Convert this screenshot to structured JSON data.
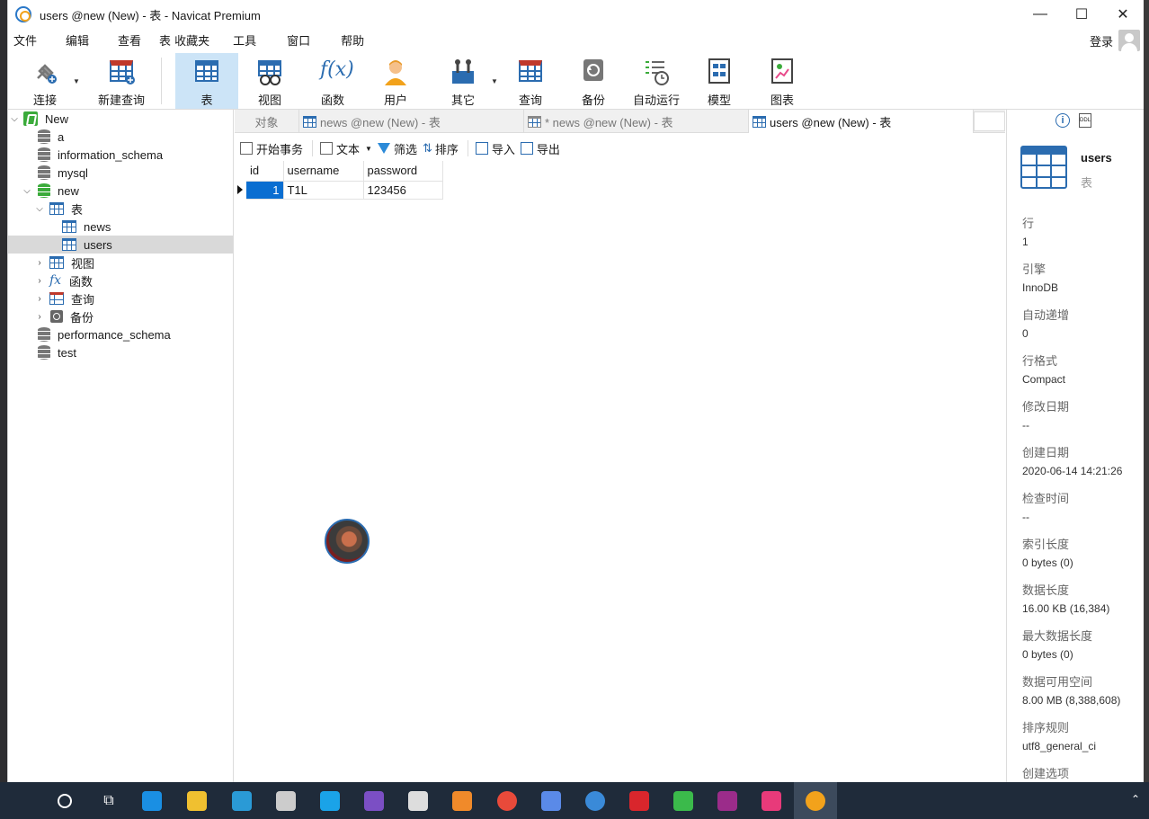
{
  "window": {
    "title": "users @new (New) - 表 - Navicat Premium",
    "controls": [
      "—",
      "☐",
      "✕"
    ]
  },
  "menu": [
    "文件",
    "编辑",
    "查看",
    "表",
    "收藏夹",
    "工具",
    "窗口",
    "帮助"
  ],
  "login_label": "登录",
  "toolbar": [
    {
      "label": "连接",
      "icon": "plug-icon",
      "has_arrow": true
    },
    {
      "label": "新建查询",
      "icon": "new-query-icon"
    },
    {
      "label": "表",
      "icon": "table-icon",
      "active": true
    },
    {
      "label": "视图",
      "icon": "view-icon"
    },
    {
      "label": "函数",
      "icon": "function-icon"
    },
    {
      "label": "用户",
      "icon": "user-icon"
    },
    {
      "label": "其它",
      "icon": "tools-icon",
      "has_arrow": true
    },
    {
      "label": "查询",
      "icon": "query-icon"
    },
    {
      "label": "备份",
      "icon": "backup-icon"
    },
    {
      "label": "自动运行",
      "icon": "schedule-icon"
    },
    {
      "label": "模型",
      "icon": "model-icon"
    },
    {
      "label": "图表",
      "icon": "chart-icon"
    }
  ],
  "tree": [
    {
      "label": "New",
      "type": "connection",
      "expanded": true
    },
    {
      "label": "a",
      "type": "db"
    },
    {
      "label": "information_schema",
      "type": "db"
    },
    {
      "label": "mysql",
      "type": "db"
    },
    {
      "label": "new",
      "type": "db-open",
      "expanded": true
    },
    {
      "label": "表",
      "type": "tables",
      "expanded": true
    },
    {
      "label": "news",
      "type": "table"
    },
    {
      "label": "users",
      "type": "table",
      "selected": true
    },
    {
      "label": "视图",
      "type": "views"
    },
    {
      "label": "函数",
      "type": "functions"
    },
    {
      "label": "查询",
      "type": "queries"
    },
    {
      "label": "备份",
      "type": "backups"
    },
    {
      "label": "performance_schema",
      "type": "db"
    },
    {
      "label": "test",
      "type": "db"
    }
  ],
  "tabs": [
    {
      "label": "对象"
    },
    {
      "label": "news @new (New) - 表"
    },
    {
      "label": "* news @new (New) - 表"
    },
    {
      "label": "users @new (New) - 表",
      "active": true
    }
  ],
  "data_toolbar": [
    "开始事务",
    "文本",
    "筛选",
    "排序",
    "导入",
    "导出"
  ],
  "grid": {
    "columns": [
      "id",
      "username",
      "password"
    ],
    "rows": [
      [
        "1",
        "T1L",
        "123456"
      ]
    ]
  },
  "info": {
    "name": "users",
    "type": "表",
    "props": [
      {
        "k": "行",
        "v": "1"
      },
      {
        "k": "引擎",
        "v": "InnoDB"
      },
      {
        "k": "自动递增",
        "v": "0"
      },
      {
        "k": "行格式",
        "v": "Compact"
      },
      {
        "k": "修改日期",
        "v": "--"
      },
      {
        "k": "创建日期",
        "v": "2020-06-14 14:21:26"
      },
      {
        "k": "检查时间",
        "v": "--"
      },
      {
        "k": "索引长度",
        "v": "0 bytes (0)"
      },
      {
        "k": "数据长度",
        "v": "16.00 KB (16,384)"
      },
      {
        "k": "最大数据长度",
        "v": "0 bytes (0)"
      },
      {
        "k": "数据可用空间",
        "v": "8.00 MB (8,388,608)"
      },
      {
        "k": "排序规则",
        "v": "utf8_general_ci"
      },
      {
        "k": "创建选项",
        "v": ""
      }
    ]
  },
  "taskbar": {
    "apps": [
      "search",
      "task-view",
      "edge",
      "explorer",
      "app-blue",
      "app-animal",
      "app-blue2",
      "visual-studio",
      "app-box",
      "app-orange",
      "chrome",
      "app-arrow",
      "app-bird",
      "netease-music",
      "wechat",
      "winrar",
      "jetbrains",
      "navicat"
    ],
    "colors": [
      "#ffffff",
      "#ffffff",
      "#1a8fe3",
      "#f0c030",
      "#2a9ad6",
      "#cccccc",
      "#1aa3e8",
      "#7b4fc4",
      "#dddddd",
      "#f08a2a",
      "#e84a3a",
      "#5a8ae8",
      "#3a8ad8",
      "#d9262c",
      "#3bba4b",
      "#9b2c8a",
      "#e83a7a",
      "#f2a21b"
    ]
  }
}
